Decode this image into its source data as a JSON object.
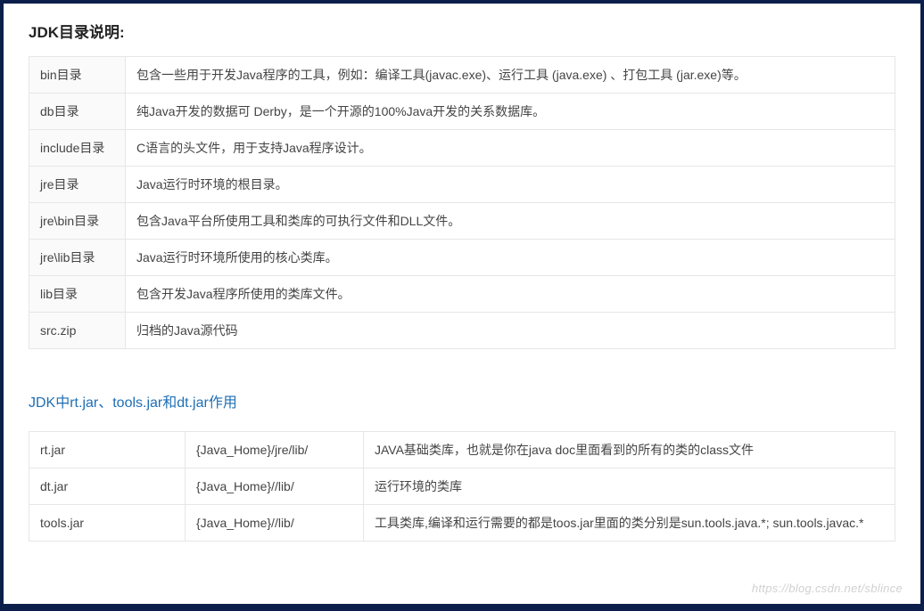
{
  "section1": {
    "title": "JDK目录说明:",
    "rows": [
      {
        "dir": "bin目录",
        "desc": "包含一些用于开发Java程序的工具，例如：编译工具(javac.exe)、运行工具 (java.exe) 、打包工具 (jar.exe)等。"
      },
      {
        "dir": "db目录",
        "desc": "纯Java开发的数据可 Derby，是一个开源的100%Java开发的关系数据库。"
      },
      {
        "dir": "include目录",
        "desc": "C语言的头文件，用于支持Java程序设计。"
      },
      {
        "dir": "jre目录",
        "desc": "Java运行时环境的根目录。"
      },
      {
        "dir": "jre\\bin目录",
        "desc": "包含Java平台所使用工具和类库的可执行文件和DLL文件。"
      },
      {
        "dir": "jre\\lib目录",
        "desc": "Java运行时环境所使用的核心类库。"
      },
      {
        "dir": "lib目录",
        "desc": "包含开发Java程序所使用的类库文件。"
      },
      {
        "dir": "src.zip",
        "desc": "归档的Java源代码"
      }
    ]
  },
  "section2": {
    "heading": "JDK中rt.jar、tools.jar和dt.jar作用",
    "rows": [
      {
        "jar": "rt.jar",
        "path": "{Java_Home}/jre/lib/",
        "desc": "JAVA基础类库，也就是你在java doc里面看到的所有的类的class文件"
      },
      {
        "jar": "dt.jar",
        "path": "{Java_Home}//lib/",
        "desc": "运行环境的类库"
      },
      {
        "jar": "tools.jar",
        "path": "{Java_Home}//lib/",
        "desc": "工具类库,编译和运行需要的都是toos.jar里面的类分别是sun.tools.java.*; sun.tools.javac.*"
      }
    ]
  },
  "watermark": "https://blog.csdn.net/sblince"
}
